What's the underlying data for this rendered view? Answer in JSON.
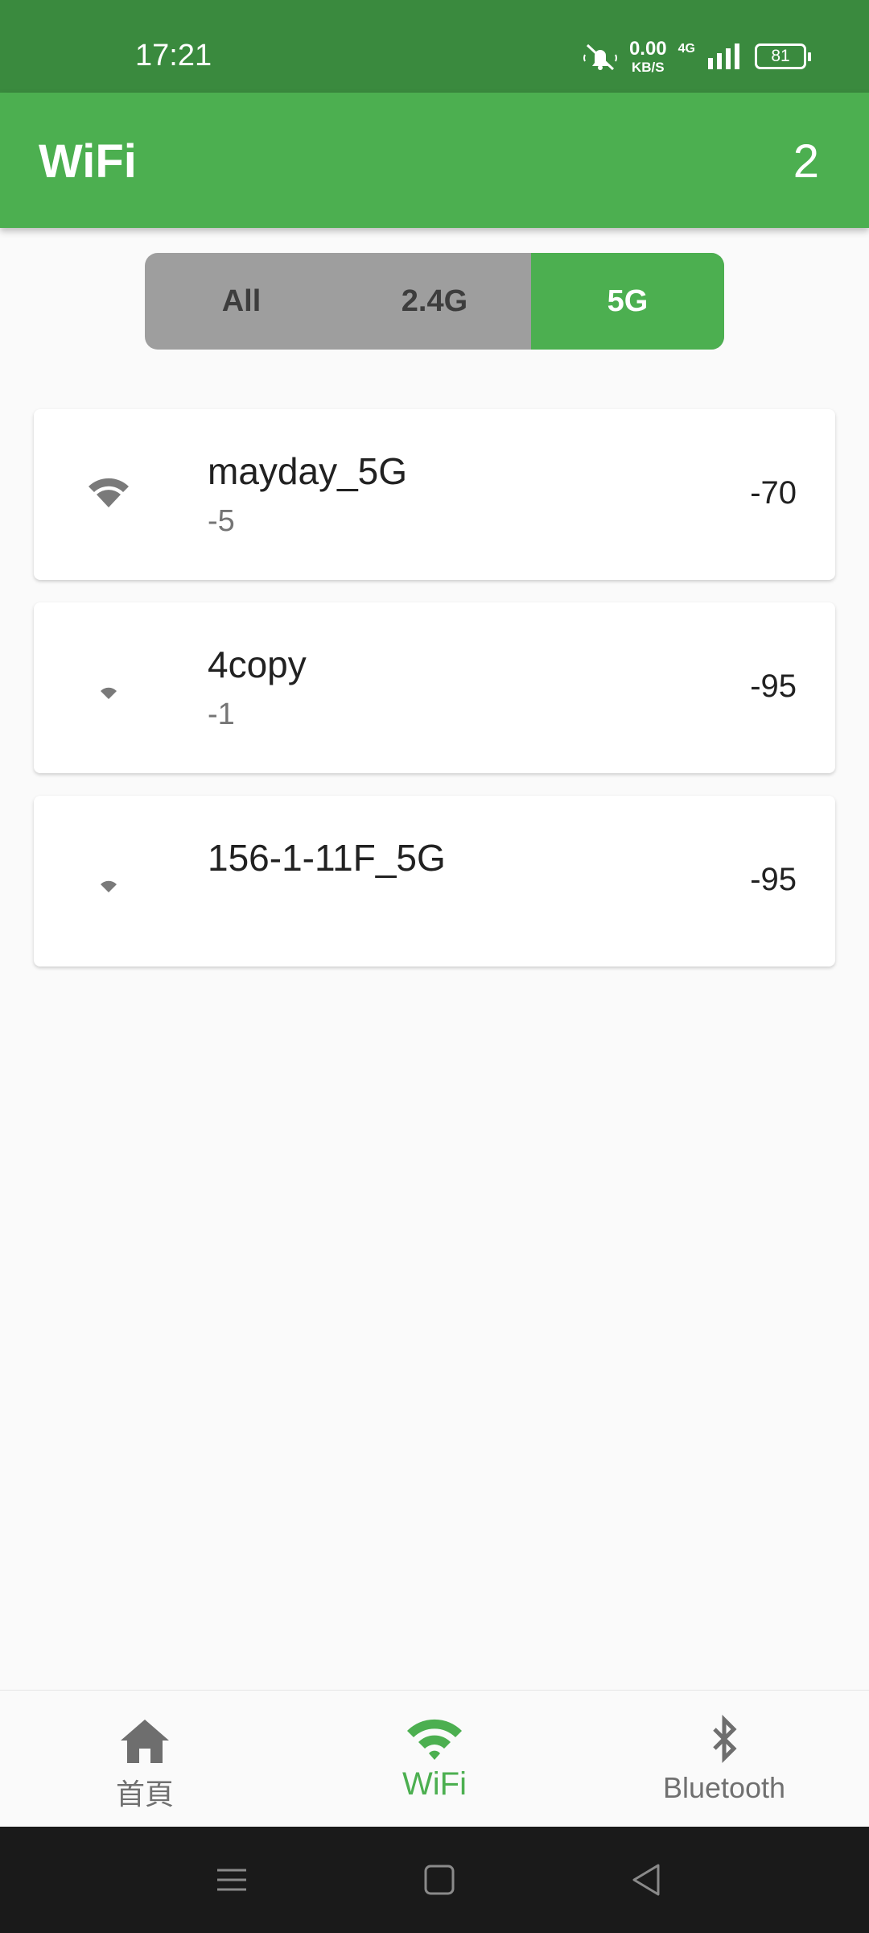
{
  "status_bar": {
    "time": "17:21",
    "net_speed_value": "0.00",
    "net_speed_unit": "KB/S",
    "network_type": "4G",
    "battery": "81",
    "icons": [
      "mute-icon",
      "signal-icon",
      "battery-icon"
    ]
  },
  "app_bar": {
    "title": "WiFi",
    "count": "2"
  },
  "filter": {
    "options": [
      "All",
      "2.4G",
      "5G"
    ],
    "selected": "5G",
    "active_color": "#4caf50",
    "inactive_color": "#9e9e9e"
  },
  "networks": [
    {
      "ssid": "mayday_5G",
      "channel": "-5",
      "rssi": "-70",
      "icon": "wifi-signal-medium-icon"
    },
    {
      "ssid": "4copy",
      "channel": "-1",
      "rssi": "-95",
      "icon": "wifi-signal-weak-icon"
    },
    {
      "ssid": "156-1-11F_5G",
      "channel": "",
      "rssi": "-95",
      "icon": "wifi-signal-weak-icon"
    }
  ],
  "bottom_nav": {
    "items": [
      {
        "label": "首頁",
        "icon": "home-icon"
      },
      {
        "label": "WiFi",
        "icon": "wifi-icon"
      },
      {
        "label": "Bluetooth",
        "icon": "bluetooth-icon"
      }
    ],
    "active": "WiFi"
  },
  "system_nav": {
    "icons": [
      "menu-icon",
      "home-square-icon",
      "back-icon"
    ]
  },
  "colors": {
    "status_bar": "#3a8a3e",
    "primary": "#4caf50",
    "background": "#fafafa"
  }
}
